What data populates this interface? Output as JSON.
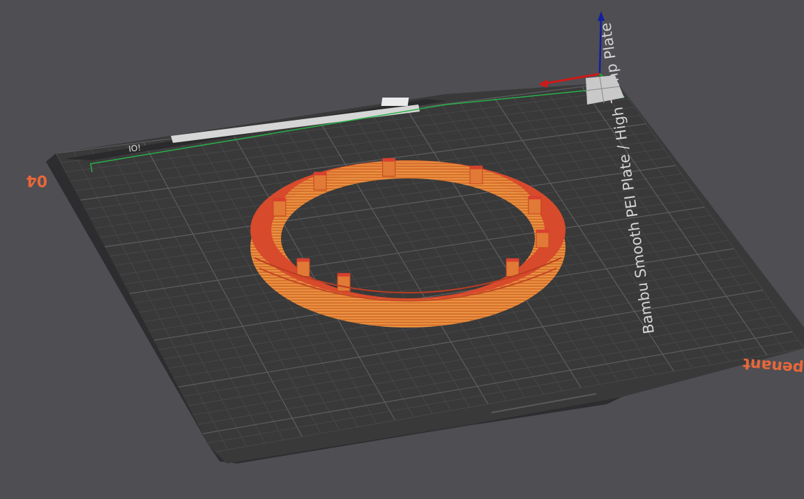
{
  "scene": {
    "plate_name": "Bambu Smooth PEI Plate / High Temp Plate",
    "plate_number": "04",
    "plate_label_partial": "penant",
    "colors": {
      "background": "#4e4e53",
      "bed": "#393939",
      "bed_edge": "#2a2a2c",
      "grid": "#555558",
      "model_outer": "#d9682a",
      "model_top": "#d8402e",
      "model_highlight": "#f0a050",
      "accent_orange": "#e8673a",
      "axis_x": "#d01818",
      "axis_y": "#18a030",
      "axis_z": "#1020a0"
    },
    "icons": {
      "axes": "axes-gizmo-icon",
      "plate_code": "qr-code-icon",
      "logo": "bambu-logo-icon"
    }
  }
}
